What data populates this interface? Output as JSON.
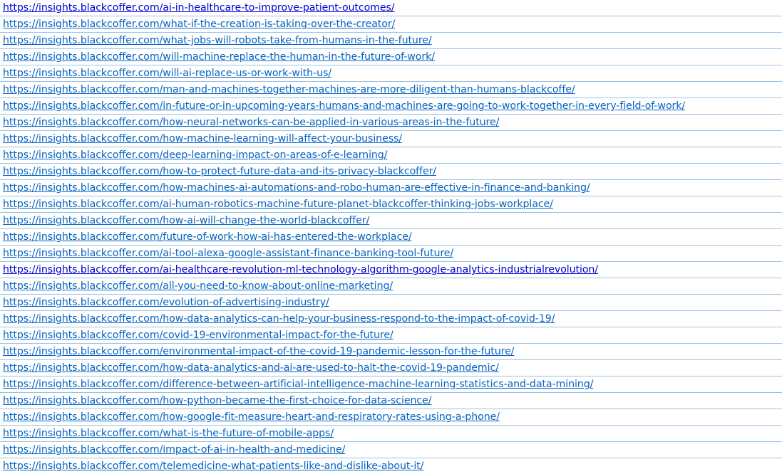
{
  "links": [
    {
      "url": "https://insights.blackcoffer.com/ai-in-healthcare-to-improve-patient-outcomes/",
      "style": "dark"
    },
    {
      "url": "https://insights.blackcoffer.com/what-if-the-creation-is-taking-over-the-creator/",
      "style": "normal"
    },
    {
      "url": "https://insights.blackcoffer.com/what-jobs-will-robots-take-from-humans-in-the-future/",
      "style": "normal"
    },
    {
      "url": "https://insights.blackcoffer.com/will-machine-replace-the-human-in-the-future-of-work/",
      "style": "normal"
    },
    {
      "url": "https://insights.blackcoffer.com/will-ai-replace-us-or-work-with-us/",
      "style": "normal"
    },
    {
      "url": "https://insights.blackcoffer.com/man-and-machines-together-machines-are-more-diligent-than-humans-blackcoffe/",
      "style": "normal"
    },
    {
      "url": "https://insights.blackcoffer.com/in-future-or-in-upcoming-years-humans-and-machines-are-going-to-work-together-in-every-field-of-work/",
      "style": "normal"
    },
    {
      "url": "https://insights.blackcoffer.com/how-neural-networks-can-be-applied-in-various-areas-in-the-future/",
      "style": "normal"
    },
    {
      "url": "https://insights.blackcoffer.com/how-machine-learning-will-affect-your-business/",
      "style": "normal"
    },
    {
      "url": "https://insights.blackcoffer.com/deep-learning-impact-on-areas-of-e-learning/",
      "style": "normal"
    },
    {
      "url": "https://insights.blackcoffer.com/how-to-protect-future-data-and-its-privacy-blackcoffer/",
      "style": "normal"
    },
    {
      "url": "https://insights.blackcoffer.com/how-machines-ai-automations-and-robo-human-are-effective-in-finance-and-banking/",
      "style": "normal"
    },
    {
      "url": "https://insights.blackcoffer.com/ai-human-robotics-machine-future-planet-blackcoffer-thinking-jobs-workplace/",
      "style": "normal"
    },
    {
      "url": "https://insights.blackcoffer.com/how-ai-will-change-the-world-blackcoffer/",
      "style": "normal"
    },
    {
      "url": "https://insights.blackcoffer.com/future-of-work-how-ai-has-entered-the-workplace/",
      "style": "normal"
    },
    {
      "url": "https://insights.blackcoffer.com/ai-tool-alexa-google-assistant-finance-banking-tool-future/",
      "style": "normal"
    },
    {
      "url": "https://insights.blackcoffer.com/ai-healthcare-revolution-ml-technology-algorithm-google-analytics-industrialrevolution/",
      "style": "dark"
    },
    {
      "url": "https://insights.blackcoffer.com/all-you-need-to-know-about-online-marketing/",
      "style": "normal"
    },
    {
      "url": "https://insights.blackcoffer.com/evolution-of-advertising-industry/",
      "style": "normal"
    },
    {
      "url": "https://insights.blackcoffer.com/how-data-analytics-can-help-your-business-respond-to-the-impact-of-covid-19/",
      "style": "normal"
    },
    {
      "url": "https://insights.blackcoffer.com/covid-19-environmental-impact-for-the-future/",
      "style": "normal"
    },
    {
      "url": "https://insights.blackcoffer.com/environmental-impact-of-the-covid-19-pandemic-lesson-for-the-future/",
      "style": "normal"
    },
    {
      "url": "https://insights.blackcoffer.com/how-data-analytics-and-ai-are-used-to-halt-the-covid-19-pandemic/",
      "style": "normal"
    },
    {
      "url": "https://insights.blackcoffer.com/difference-between-artificial-intelligence-machine-learning-statistics-and-data-mining/",
      "style": "normal"
    },
    {
      "url": "https://insights.blackcoffer.com/how-python-became-the-first-choice-for-data-science/",
      "style": "normal"
    },
    {
      "url": "https://insights.blackcoffer.com/how-google-fit-measure-heart-and-respiratory-rates-using-a-phone/",
      "style": "normal"
    },
    {
      "url": "https://insights.blackcoffer.com/what-is-the-future-of-mobile-apps/",
      "style": "normal"
    },
    {
      "url": "https://insights.blackcoffer.com/impact-of-ai-in-health-and-medicine/",
      "style": "normal"
    },
    {
      "url": "https://insights.blackcoffer.com/telemedicine-what-patients-like-and-dislike-about-it/",
      "style": "normal"
    }
  ],
  "colors": {
    "link": "#0563c1",
    "link_dark": "#0000d4",
    "gridline": "#9bc2e6",
    "background": "#ffffff"
  }
}
